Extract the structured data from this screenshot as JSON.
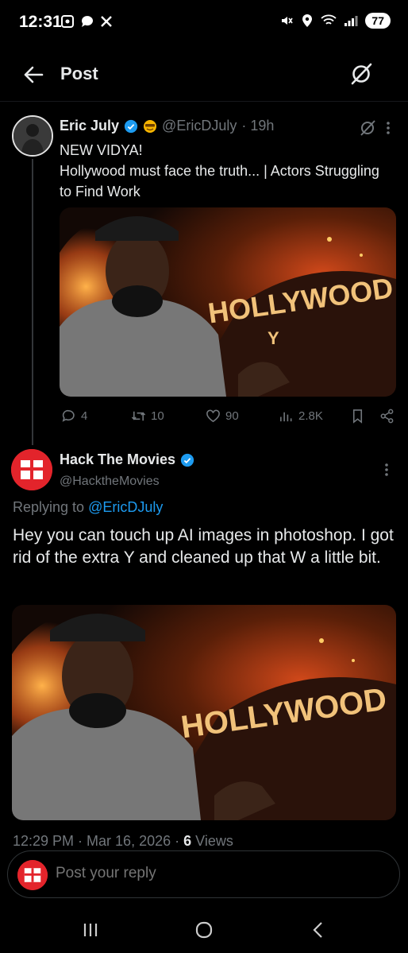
{
  "status_bar": {
    "time": "12:31",
    "battery": "77"
  },
  "header": {
    "title": "Post"
  },
  "tweet1": {
    "name": "Eric July",
    "handle": "@EricDJuly",
    "age": "· 19h",
    "text_line1": "NEW VIDYA!",
    "text_line2": "Hollywood must face the truth... | Actors Struggling to Find Work",
    "image_sign": "HOLLYWOOD",
    "image_extra": "Y",
    "replies": "4",
    "reposts": "10",
    "likes": "90",
    "views": "2.8K"
  },
  "tweet2": {
    "name": "Hack The Movies",
    "handle": "@HacktheMovies",
    "replying_prefix": "Replying to",
    "replying_to": "@EricDJuly",
    "text": "Hey you can touch up AI images in photoshop. I got rid of the extra Y and cleaned up that W a little bit.",
    "image_sign": "HOLLYWOOD",
    "time": "12:29 PM · Mar 16, 2026 ·",
    "views_count": "6",
    "views_label": "Views"
  },
  "reply_bar": {
    "placeholder": "Post your reply"
  },
  "colors": {
    "accent": "#1d9bf0",
    "muted": "#71767b",
    "brand_red": "#e3242b"
  }
}
